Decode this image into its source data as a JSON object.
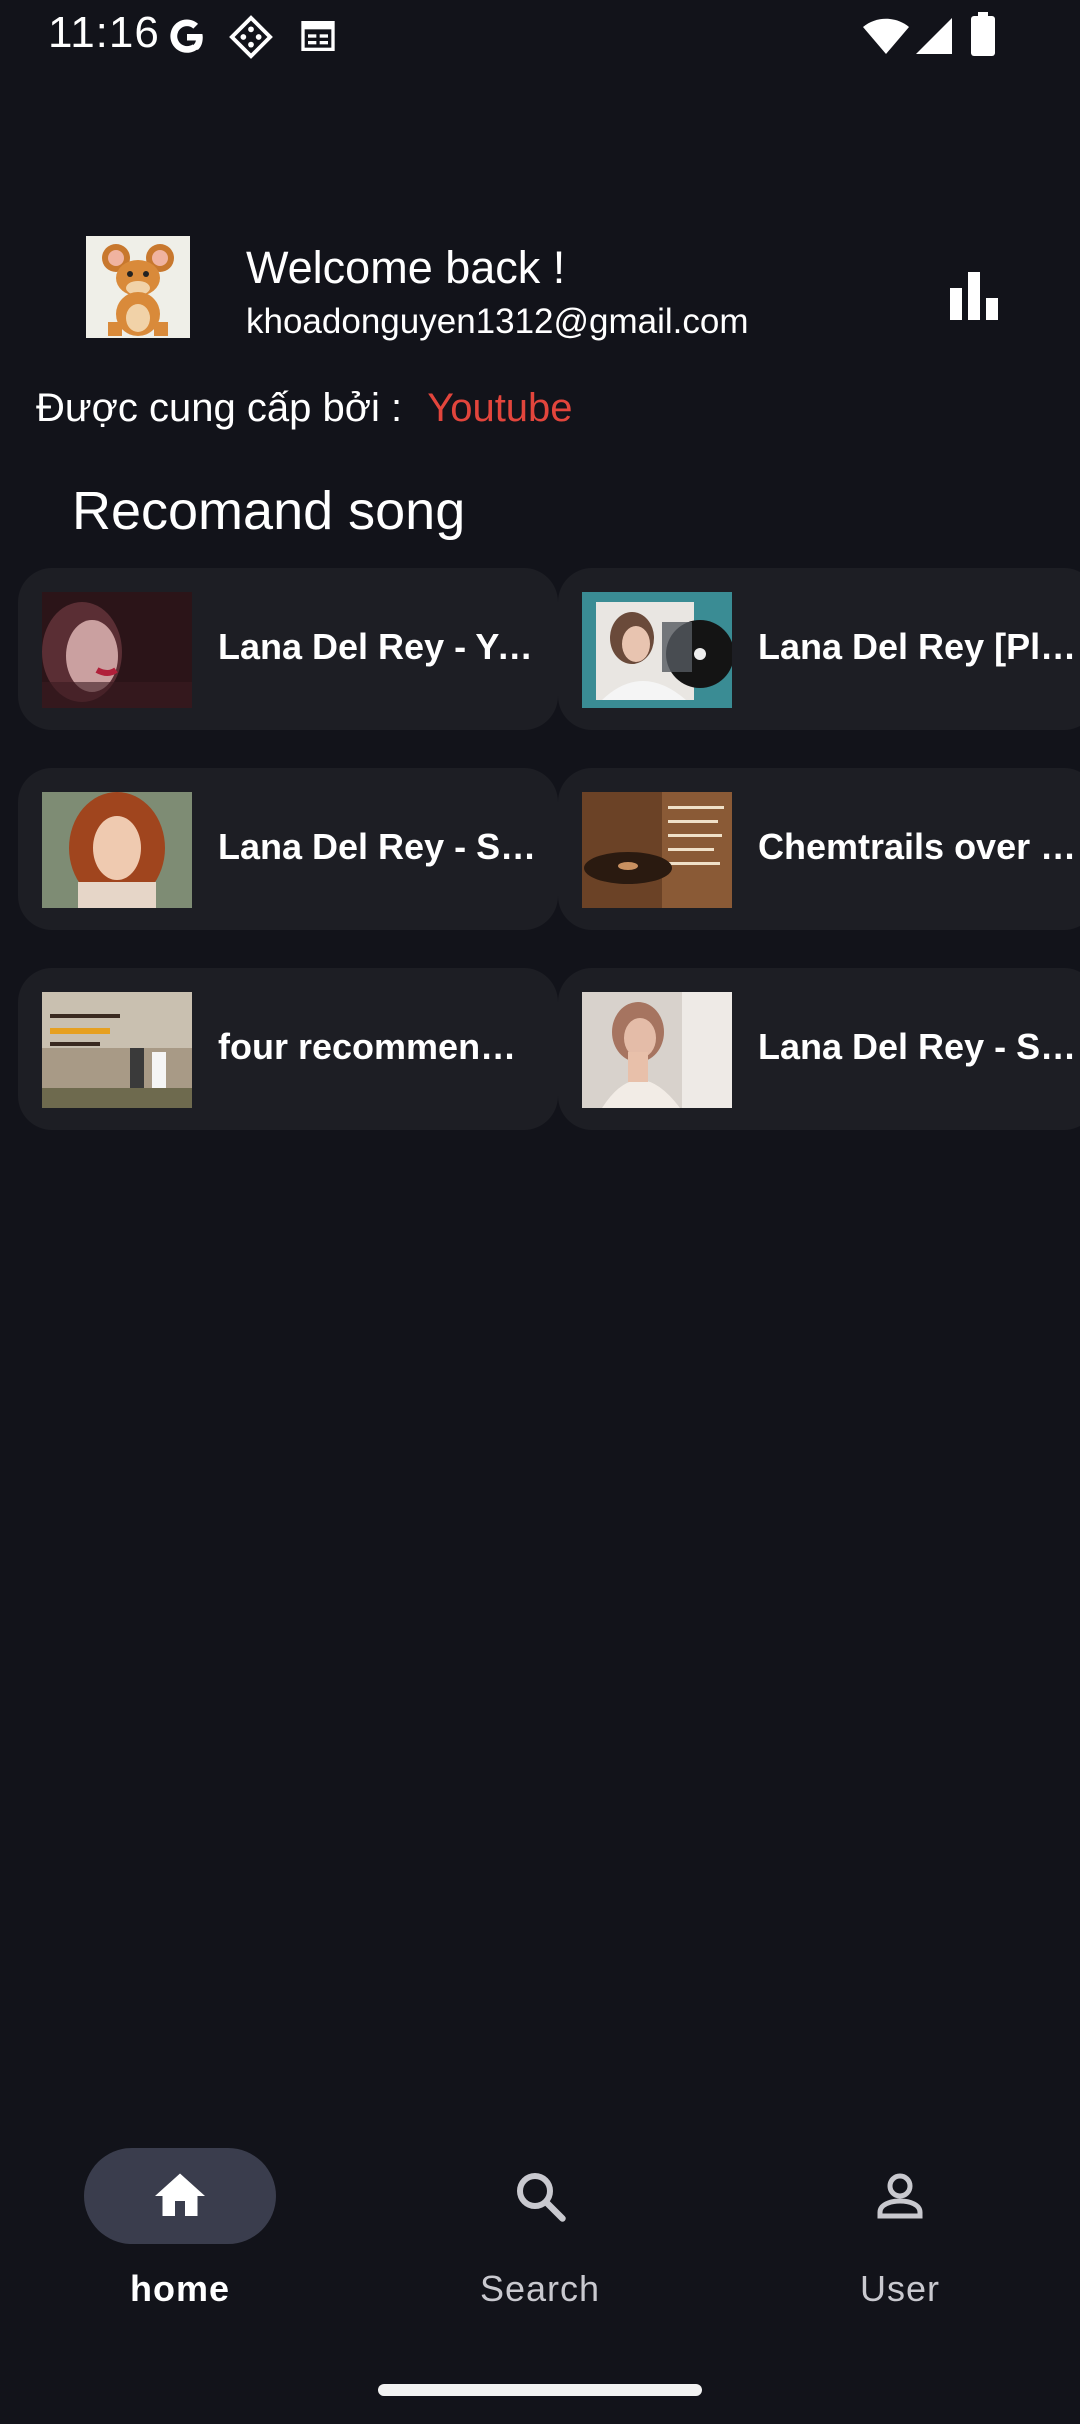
{
  "status_bar": {
    "time": "11:16",
    "left_icons": [
      "google-g-icon",
      "game-icon",
      "calendar-icon"
    ],
    "right_icons": [
      "wifi-icon",
      "signal-icon",
      "battery-icon"
    ]
  },
  "header": {
    "welcome": "Welcome back !",
    "email": "khoadonguyen1312@gmail.com",
    "avatar_icon": "avatar-jerry-icon",
    "chart_icon": "bar-chart-icon"
  },
  "provider": {
    "label": "Được cung cấp bởi :",
    "source": "Youtube",
    "source_color": "#e2453c"
  },
  "section": {
    "title": "Recomand song"
  },
  "songs": [
    {
      "title": "Lana Del Rey - Yo..."
    },
    {
      "title": "Lana Del Rey [Pla..."
    },
    {
      "title": "Lana Del Rey - Su..."
    },
    {
      "title": "Chemtrails over t..."
    },
    {
      "title": "four recommende..."
    },
    {
      "title": "Lana Del Rey - Sa..."
    }
  ],
  "bottom_nav": {
    "items": [
      {
        "label": "home",
        "icon": "home-icon",
        "active": true
      },
      {
        "label": "Search",
        "icon": "search-icon",
        "active": false
      },
      {
        "label": "User",
        "icon": "user-icon",
        "active": false
      }
    ]
  },
  "colors": {
    "background": "#12131a",
    "card": "#1d1e24",
    "nav_pill": "#3a3d4d",
    "accent": "#e2453c"
  }
}
